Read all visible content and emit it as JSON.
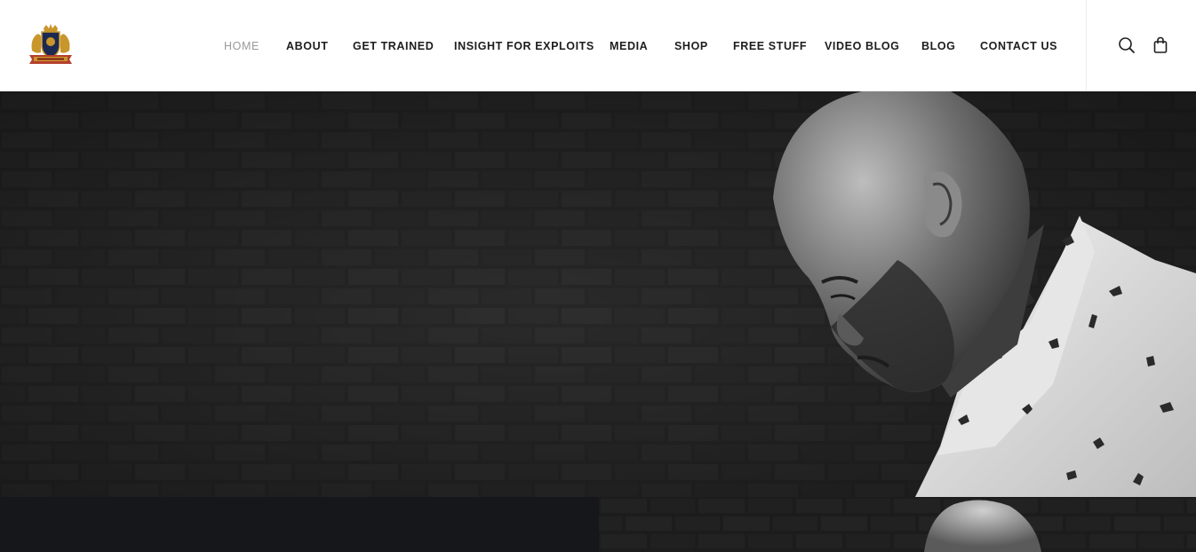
{
  "header": {
    "logo_alt": "site logo",
    "nav": [
      {
        "label": "HOME",
        "active": true
      },
      {
        "label": "ABOUT",
        "active": false
      },
      {
        "label": "GET TRAINED",
        "active": false
      },
      {
        "label": "INSIGHT FOR EXPLOITS",
        "active": false
      },
      {
        "label": "MEDIA",
        "active": false
      },
      {
        "label": "SHOP",
        "active": false
      },
      {
        "label": "FREE STUFF",
        "active": false
      },
      {
        "label": "VIDEO BLOG",
        "active": false
      },
      {
        "label": "BLOG",
        "active": false
      },
      {
        "label": "CONTACT US",
        "active": false
      }
    ],
    "icons": {
      "search": "search-icon",
      "cart": "shopping-bag-icon"
    }
  },
  "colors": {
    "nav_text": "#1d1d1d",
    "nav_active": "#9a9a9a",
    "hero_bg": "#262626",
    "bottom_left_bg": "#16171a",
    "logo_gold": "#c9962b",
    "logo_navy": "#1c2a52"
  }
}
